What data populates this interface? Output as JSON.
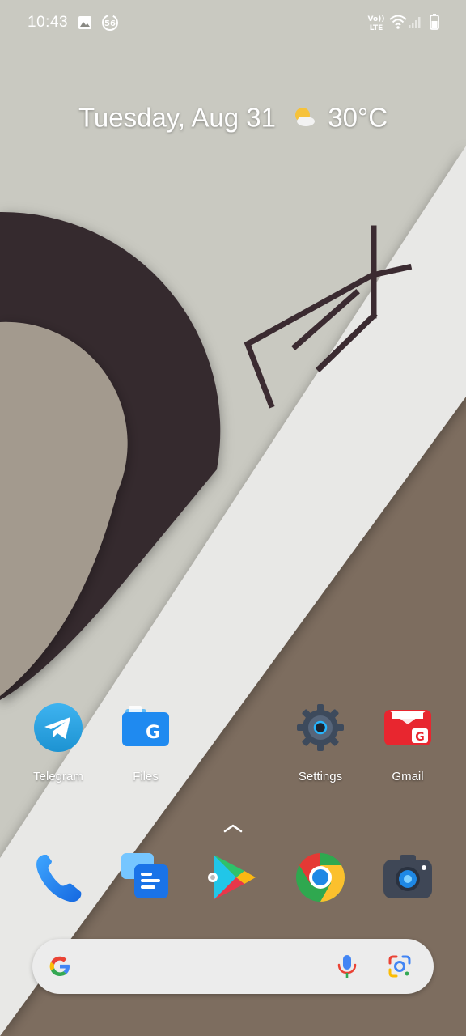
{
  "status_bar": {
    "time": "10:43",
    "icons": [
      "image-icon",
      "data-saver-icon",
      "volte-lte-icon",
      "wifi-icon",
      "signal-icon",
      "battery-icon"
    ],
    "volte_text": "Vo))",
    "lte_text": "LTE",
    "data_saver_text": "56"
  },
  "glance": {
    "date": "Tuesday, Aug 31",
    "weather_icon": "partly-cloudy-icon",
    "temperature": "30°C"
  },
  "home_apps": [
    {
      "label": "Telegram",
      "icon": "telegram-icon"
    },
    {
      "label": "Files",
      "icon": "files-icon"
    },
    {
      "label": "Settings",
      "icon": "settings-icon"
    },
    {
      "label": "Gmail",
      "icon": "gmail-icon"
    }
  ],
  "dock_apps": [
    {
      "name": "Phone",
      "icon": "phone-icon"
    },
    {
      "name": "Messages",
      "icon": "messages-icon"
    },
    {
      "name": "Play Store",
      "icon": "play-store-icon"
    },
    {
      "name": "Chrome",
      "icon": "chrome-icon"
    },
    {
      "name": "Camera",
      "icon": "camera-icon"
    }
  ],
  "search_bar": {
    "icons": [
      "google-logo-icon",
      "microphone-icon",
      "lens-icon"
    ]
  },
  "colors": {
    "wallpaper_top": "#c9c9c1",
    "wallpaper_bottom": "#7d6d5f",
    "band": "#e8e8e6",
    "arc": "#35292e",
    "disc": "#a39a8e",
    "search_bg": "#ececec"
  }
}
